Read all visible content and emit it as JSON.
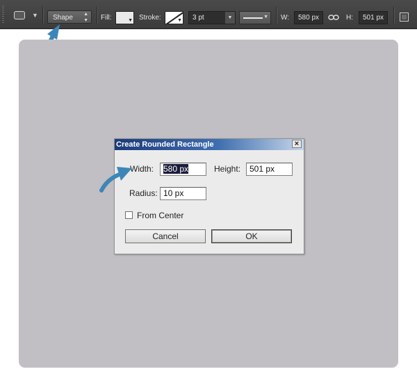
{
  "options_bar": {
    "mode_value": "Shape",
    "fill_label": "Fill:",
    "stroke_label": "Stroke:",
    "stroke_width": "3 pt",
    "width_label": "W:",
    "width_value": "580 px",
    "height_label": "H:",
    "height_value": "501 px",
    "icons": [
      "rounded-rectangle-tool-icon",
      "link-dimensions-icon",
      "path-operations-icon"
    ]
  },
  "dialog": {
    "title": "Create Rounded Rectangle",
    "width_label": "Width:",
    "width_value": "580 px",
    "height_label": "Height:",
    "height_value": "501 px",
    "radius_label": "Radius:",
    "radius_value": "10 px",
    "from_center_label": "From Center",
    "from_center_checked": false,
    "cancel_label": "Cancel",
    "ok_label": "OK"
  },
  "colors": {
    "canvas": "#c1bfc3",
    "hint_arrow": "#4a90c0",
    "toolbar": "#444444"
  }
}
